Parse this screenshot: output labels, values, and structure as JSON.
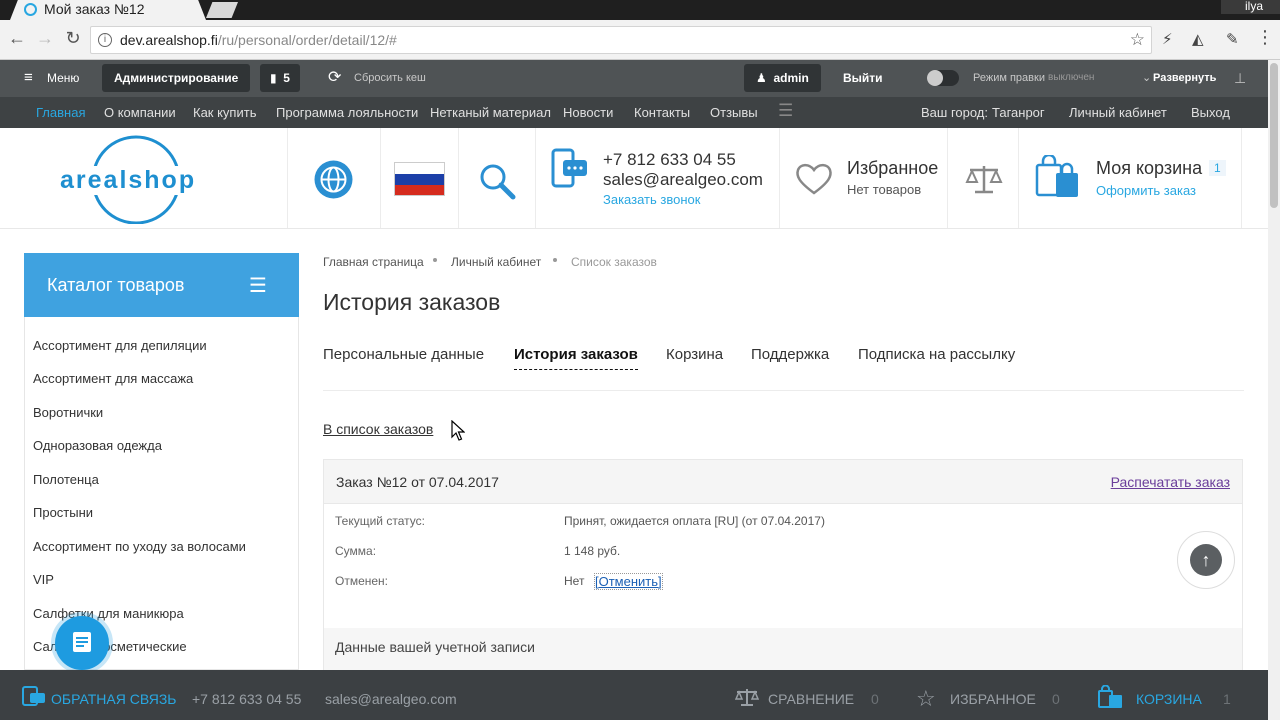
{
  "browser": {
    "tab_title": "Мой заказ №12",
    "profile_name": "ilya",
    "url_host": "dev.arealshop.fi",
    "url_path": "/ru/personal/order/detail/12/#"
  },
  "admin_bar": {
    "menu": "Меню",
    "admin": "Администрирование",
    "notifications_count": "5",
    "clear_cache": "Сбросить кеш",
    "user": "admin",
    "logout": "Выйти",
    "edit_mode_label": "Режим правки",
    "edit_mode_state": "выключен",
    "expand": "Развернуть"
  },
  "site_nav": {
    "items": [
      "Главная",
      "О компании",
      "Как купить",
      "Программа лояльности",
      "Нетканый материал",
      "Новости",
      "Контакты",
      "Отзывы"
    ],
    "city_label": "Ваш город:",
    "city": "Таганрог",
    "cabinet": "Личный кабинет",
    "exit": "Выход"
  },
  "header": {
    "logo_text": "arealshop",
    "phone": "+7 812 633 04 55",
    "email": "sales@arealgeo.com",
    "callback": "Заказать звонок",
    "favorites_title": "Избранное",
    "favorites_sub": "Нет товаров",
    "cart_title": "Моя корзина",
    "cart_count": "1",
    "cart_checkout": "Оформить заказ"
  },
  "sidebar": {
    "title": "Каталог товаров",
    "items": [
      "Ассортимент для депиляции",
      "Ассортимент для массажа",
      "Воротнички",
      "Одноразовая одежда",
      "Полотенца",
      "Простыни",
      "Ассортимент по уходу за волосами",
      "VIP",
      "Салфетки для маникюра",
      "Салфетки косметические"
    ]
  },
  "main": {
    "breadcrumb": [
      "Главная страница",
      "Личный кабинет",
      "Список заказов"
    ],
    "title": "История заказов",
    "tabs": [
      "Персональные данные",
      "История заказов",
      "Корзина",
      "Поддержка",
      "Подписка на рассылку"
    ],
    "back_link": "В список заказов",
    "order": {
      "title": "Заказ №12 от 07.04.2017",
      "print": "Распечатать заказ",
      "status_label": "Текущий статус:",
      "status_value": "Принят, ожидается оплата [RU] (от 07.04.2017)",
      "sum_label": "Сумма:",
      "sum_value": "1 148 руб.",
      "canceled_label": "Отменен:",
      "canceled_value": "Нет",
      "cancel_link": "[Отменить]",
      "account_section": "Данные вашей учетной записи"
    }
  },
  "bottom_bar": {
    "feedback": "ОБРАТНАЯ СВЯЗЬ",
    "phone": "+7 812 633 04 55",
    "email": "sales@arealgeo.com",
    "compare": "СРАВНЕНИЕ",
    "compare_count": "0",
    "favorites": "ИЗБРАННОЕ",
    "favorites_count": "0",
    "cart": "КОРЗИНА",
    "cart_count": "1"
  },
  "colors": {
    "accent": "#29a7e1",
    "catalog_header": "#3fa2e0",
    "admin_bar": "#4f5355",
    "site_nav": "#3e4244",
    "bottom_bar": "#3c4043"
  }
}
